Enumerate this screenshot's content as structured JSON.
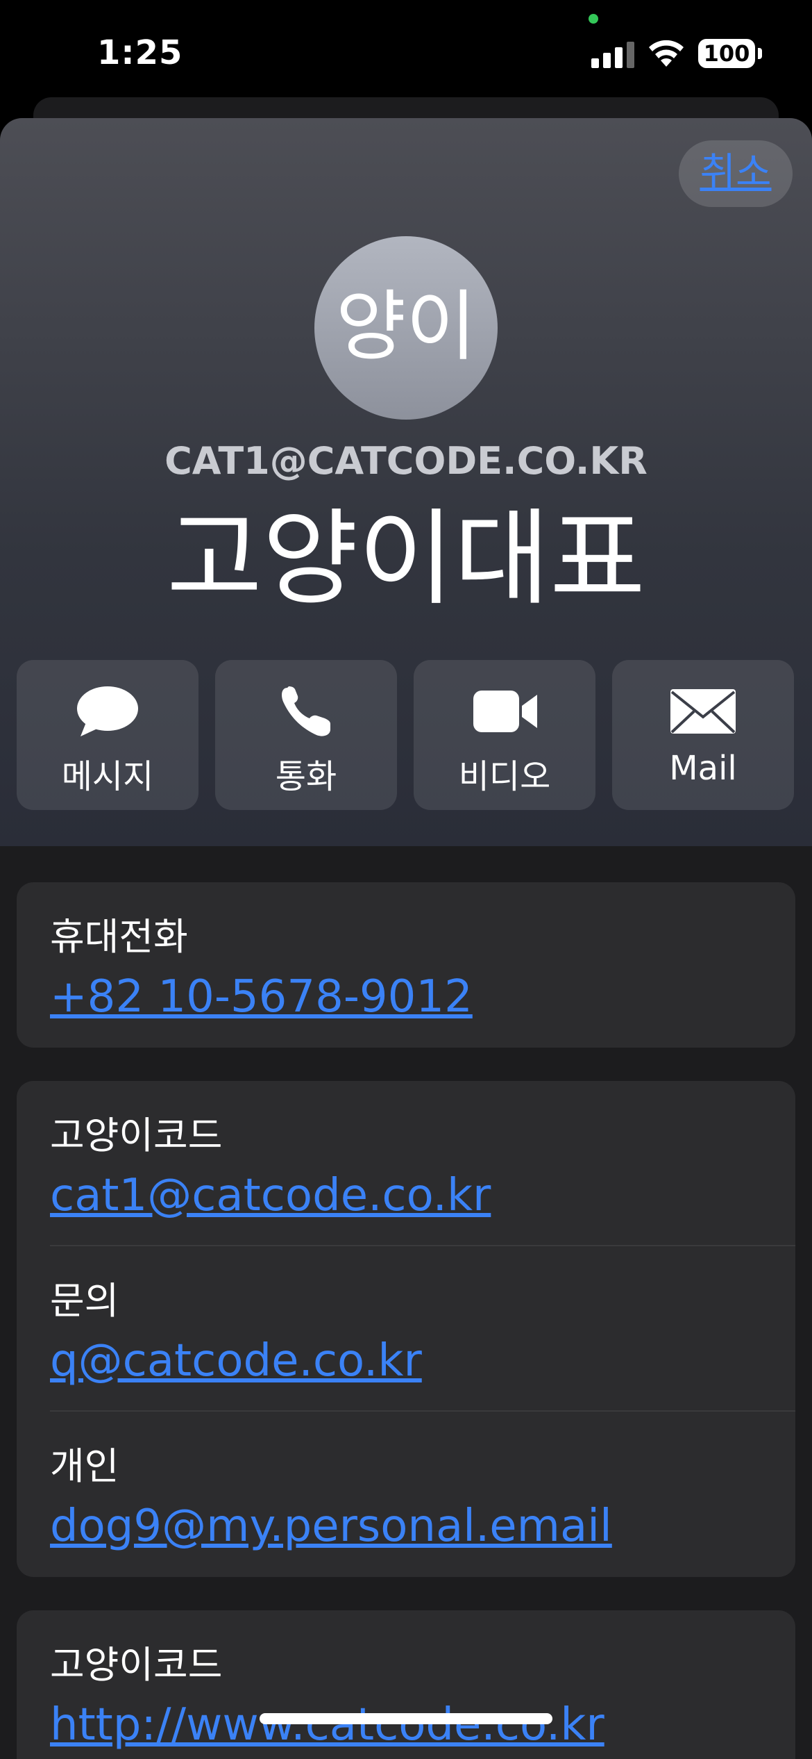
{
  "status_bar": {
    "time": "1:25",
    "battery": "100"
  },
  "header": {
    "cancel_label": "취소",
    "avatar_initials": "양이",
    "company": "CAT1@CATCODE.CO.KR",
    "name": "고양이대표"
  },
  "actions": [
    {
      "label": "메시지",
      "icon": "message-icon"
    },
    {
      "label": "통화",
      "icon": "phone-icon"
    },
    {
      "label": "비디오",
      "icon": "video-icon"
    },
    {
      "label": "Mail",
      "icon": "mail-icon"
    }
  ],
  "phone": {
    "label": "휴대전화",
    "value": "+82 10-5678-9012"
  },
  "emails": [
    {
      "label": "고양이코드",
      "value": "cat1@catcode.co.kr"
    },
    {
      "label": "문의",
      "value": "q@catcode.co.kr"
    },
    {
      "label": "개인",
      "value": "dog9@my.personal.email"
    }
  ],
  "url": {
    "label": "고양이코드",
    "value": "http://www.catcode.co.kr"
  },
  "colors": {
    "link": "#3b82f6",
    "card": "#2c2c2e",
    "background": "#1c1c1e"
  }
}
